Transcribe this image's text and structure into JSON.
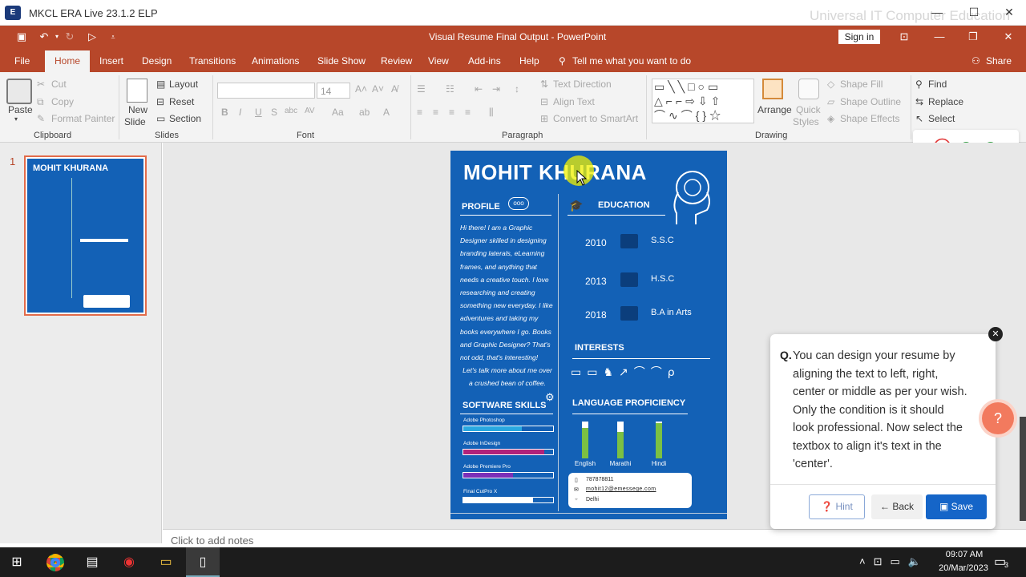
{
  "era": {
    "title": "MKCL ERA Live 23.1.2 ELP",
    "watermark": "Universal IT Computer Education",
    "logo": "era"
  },
  "ppt": {
    "window_title": "Visual Resume Final Output  -  PowerPoint",
    "sign_in": "Sign in"
  },
  "tabs": [
    "File",
    "Home",
    "Insert",
    "Design",
    "Transitions",
    "Animations",
    "Slide Show",
    "Review",
    "View",
    "Add-ins",
    "Help"
  ],
  "tell_me": "Tell me what you want to do",
  "share": "Share",
  "ribbon": {
    "clipboard": {
      "paste": "Paste",
      "cut": "Cut",
      "copy": "Copy",
      "format_painter": "Format Painter",
      "label": "Clipboard"
    },
    "slides": {
      "new_slide_1": "New",
      "new_slide_2": "Slide",
      "layout": "Layout",
      "reset": "Reset",
      "section": "Section",
      "label": "Slides"
    },
    "font": {
      "size": "14",
      "bold": "B",
      "italic": "I",
      "underline": "U",
      "strike": "S",
      "label": "Font"
    },
    "paragraph": {
      "text_direction": "Text Direction",
      "align_text": "Align Text",
      "smartart": "Convert to SmartArt",
      "label": "Paragraph"
    },
    "drawing": {
      "arrange": "Arrange",
      "quick_1": "Quick",
      "quick_2": "Styles",
      "shape_fill": "Shape Fill",
      "shape_outline": "Shape Outline",
      "shape_effects": "Shape Effects",
      "label": "Drawing"
    },
    "editing": {
      "find": "Find",
      "replace": "Replace",
      "select": "Select"
    }
  },
  "thumb_num": "1",
  "slide": {
    "name": "MOHIT KHURANA",
    "profile": "PROFILE",
    "profile_text": [
      "Hi there! I am a Graphic",
      "Designer skilled in designing",
      "branding laterals, eLearning",
      "frames, and anything that",
      "needs a creative touch. I love",
      "researching and creating",
      "something new everyday. I like",
      "adventures and taking my",
      "books everywhere I go. Books",
      "and Graphic Designer? That's",
      "not odd, that's interesting!"
    ],
    "profile_text2": [
      "Let's talk more about me over",
      "a crushed bean of coffee."
    ],
    "education": "EDUCATION",
    "edu": [
      {
        "year": "2010",
        "deg": "S.S.C"
      },
      {
        "year": "2013",
        "deg": "H.S.C"
      },
      {
        "year": "2018",
        "deg": "B.A in Arts"
      }
    ],
    "interests": "INTERESTS",
    "software": "SOFTWARE SKILLS",
    "skills": [
      {
        "name": "Adobe Photoshop",
        "level": 0.65,
        "color": "#29a8e0"
      },
      {
        "name": "Adobe InDesign",
        "level": 0.9,
        "color": "#b0227a"
      },
      {
        "name": "Adobe Premiere Pro",
        "level": 0.55,
        "color": "#7a2fb8"
      },
      {
        "name": "Final CutPro X",
        "level": 0.78,
        "color": "#ffffff"
      }
    ],
    "language": "LANGUAGE PROFICIENCY",
    "langs": [
      {
        "name": "English",
        "level": 0.82
      },
      {
        "name": "Marathi",
        "level": 0.72
      },
      {
        "name": "Hindi",
        "level": 0.95
      }
    ],
    "contact": {
      "phone": "787878811",
      "email": "mohit12@emessege.com",
      "city": "Delhi"
    }
  },
  "notes": "Click to add notes",
  "question": {
    "prefix": "Q.",
    "lines": [
      "You can design your resume by",
      "aligning the text to left, right,",
      "center or middle as per your wish.",
      "Only the condition is it should",
      "look professional. Now select the",
      "textbox to align it's text in the",
      "'center'."
    ],
    "hint": "Hint",
    "back": "Back",
    "save": "Save"
  },
  "clock": {
    "time": "09:07 AM",
    "date": "20/Mar/2023",
    "badge": "3"
  }
}
